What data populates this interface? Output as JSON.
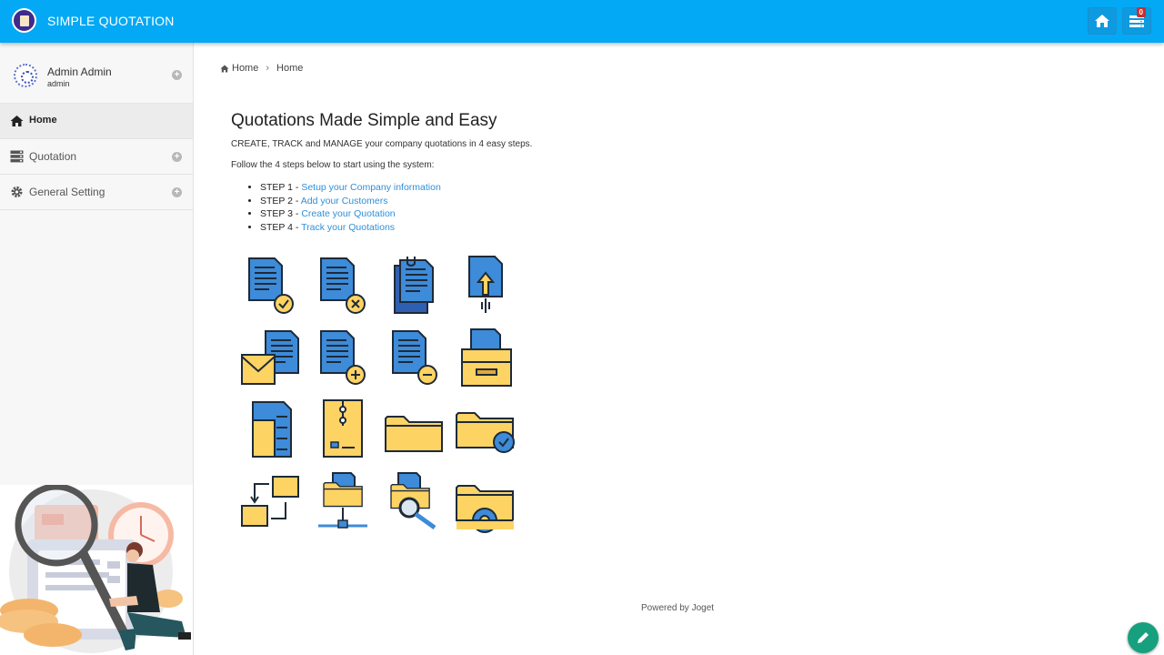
{
  "app": {
    "title": "SIMPLE QUOTATION",
    "task_count": "0"
  },
  "header": {
    "home_icon": "home-icon",
    "tasks_icon": "tasks-icon"
  },
  "user": {
    "name": "Admin Admin",
    "role": "admin"
  },
  "sidebar": {
    "items": [
      {
        "label": "Home",
        "icon": "home-icon"
      },
      {
        "label": "Quotation",
        "icon": "server-icon"
      },
      {
        "label": "General Setting",
        "icon": "gear-icon"
      }
    ]
  },
  "breadcrumb": {
    "first": "Home",
    "second": "Home"
  },
  "main": {
    "title": "Quotations Made Simple and Easy",
    "intro": "CREATE, TRACK and MANAGE your company quotations in 4 easy steps.",
    "follow": "Follow the 4 steps below to start using the system:",
    "steps": [
      {
        "prefix": "STEP 1 - ",
        "link": "Setup your Company information"
      },
      {
        "prefix": "STEP 2 - ",
        "link": "Add your Customers"
      },
      {
        "prefix": "STEP 3 - ",
        "link": "Create your Quotation"
      },
      {
        "prefix": "STEP 4 - ",
        "link": "Track your Quotations"
      }
    ]
  },
  "footer": {
    "text": "Powered by Joget"
  },
  "colors": {
    "topbar": "#03a9f4",
    "doc_blue": "#3d8bd9",
    "folder_yellow": "#fdd363",
    "link": "#2f8fd8",
    "fab": "#16a07e"
  }
}
